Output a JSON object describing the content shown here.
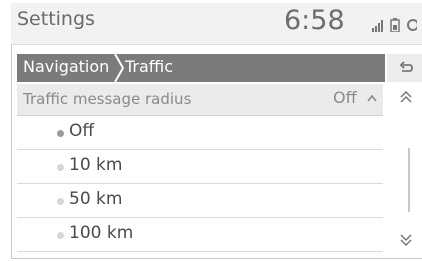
{
  "header": {
    "title": "Settings",
    "time": "6:58",
    "icons": [
      "signal-icon",
      "battery-icon"
    ]
  },
  "breadcrumb": {
    "items": [
      "Navigation",
      "Traffic"
    ],
    "back_icon": "back-arrow-icon"
  },
  "setting": {
    "label": "Traffic message radius",
    "value": "Off",
    "state_icon": "chevron-up-icon"
  },
  "options": [
    {
      "label": "Off",
      "selected": true
    },
    {
      "label": "10 km",
      "selected": false
    },
    {
      "label": "50 km",
      "selected": false
    },
    {
      "label": "100 km",
      "selected": false
    }
  ],
  "scrollbar": {
    "up_icon": "double-chevron-up-icon",
    "down_icon": "double-chevron-down-icon"
  },
  "colors": {
    "breadcrumb_bg": "#7b7b7b",
    "selected_dot": "#9a9a9a",
    "unselected_dot": "#d6d6d6"
  }
}
